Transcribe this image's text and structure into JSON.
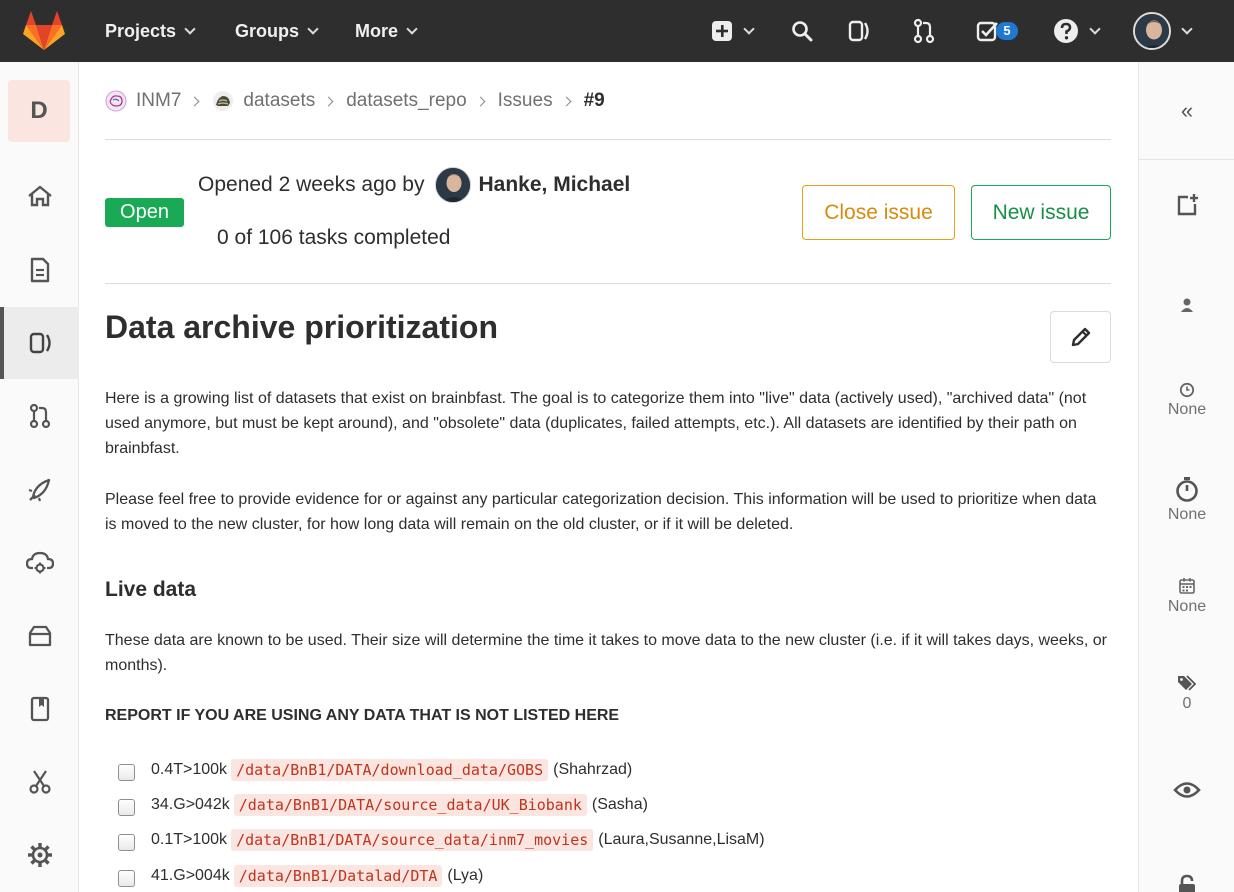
{
  "navbar": {
    "menus": [
      {
        "label": "Projects"
      },
      {
        "label": "Groups"
      },
      {
        "label": "More"
      }
    ],
    "todo_count": "5"
  },
  "sidebar": {
    "project_letter": "D"
  },
  "breadcrumb": {
    "items": [
      "INM7",
      "datasets",
      "datasets_repo",
      "Issues",
      "#9"
    ]
  },
  "issue": {
    "status": "Open",
    "opened_prefix": "Opened 2 weeks ago by",
    "author": "Hanke, Michael",
    "tasks": "0 of 106 tasks completed",
    "close_label": "Close issue",
    "new_label": "New issue",
    "title": "Data archive prioritization",
    "intro": "Here is a growing list of datasets that exist on brainbfast. The goal is to categorize them into \"live\" data (actively used), \"archived data\" (not used anymore, but must be kept around), and \"obsolete\" data (duplicates, failed attempts, etc.). All datasets are identified by their path on brainbfast.",
    "feedback": "Please feel free to provide evidence for or against any particular categorization decision. This information will be used to prioritize when data is moved to the new cluster, for how long data will remain on the old cluster, or if it will be deleted.",
    "live_heading": "Live data",
    "live_desc": "These data are known to be used. Their size will determine the time it takes to move data to the new cluster (i.e. if it will takes days, weeks, or months).",
    "report": "REPORT IF YOU ARE USING ANY DATA THAT IS NOT LISTED HERE",
    "task_items": [
      {
        "size": "0.4T>100k",
        "path": "/data/BnB1/DATA/download_data/GOBS",
        "users": "(Shahrzad)"
      },
      {
        "size": "34.G>042k",
        "path": "/data/BnB1/DATA/source_data/UK_Biobank",
        "users": "(Sasha)"
      },
      {
        "size": "0.1T>100k",
        "path": "/data/BnB1/DATA/source_data/inm7_movies",
        "users": "(Laura,Susanne,LisaM)"
      },
      {
        "size": "41.G>004k",
        "path": "/data/BnB1/Datalad/DTA",
        "users": "(Lya)"
      }
    ]
  },
  "right_sidebar": {
    "milestone": "None",
    "time_tracking": "None",
    "due_date": "None",
    "labels_count": "0"
  },
  "colors": {
    "navbar": "#2e2e2e",
    "open_badge": "#1aaa55",
    "close_border": "#e6a11b",
    "new_border": "#1aaa55",
    "code_text": "#c0341d",
    "code_bg": "#fbe5e1",
    "todo_badge": "#1f78d1"
  }
}
